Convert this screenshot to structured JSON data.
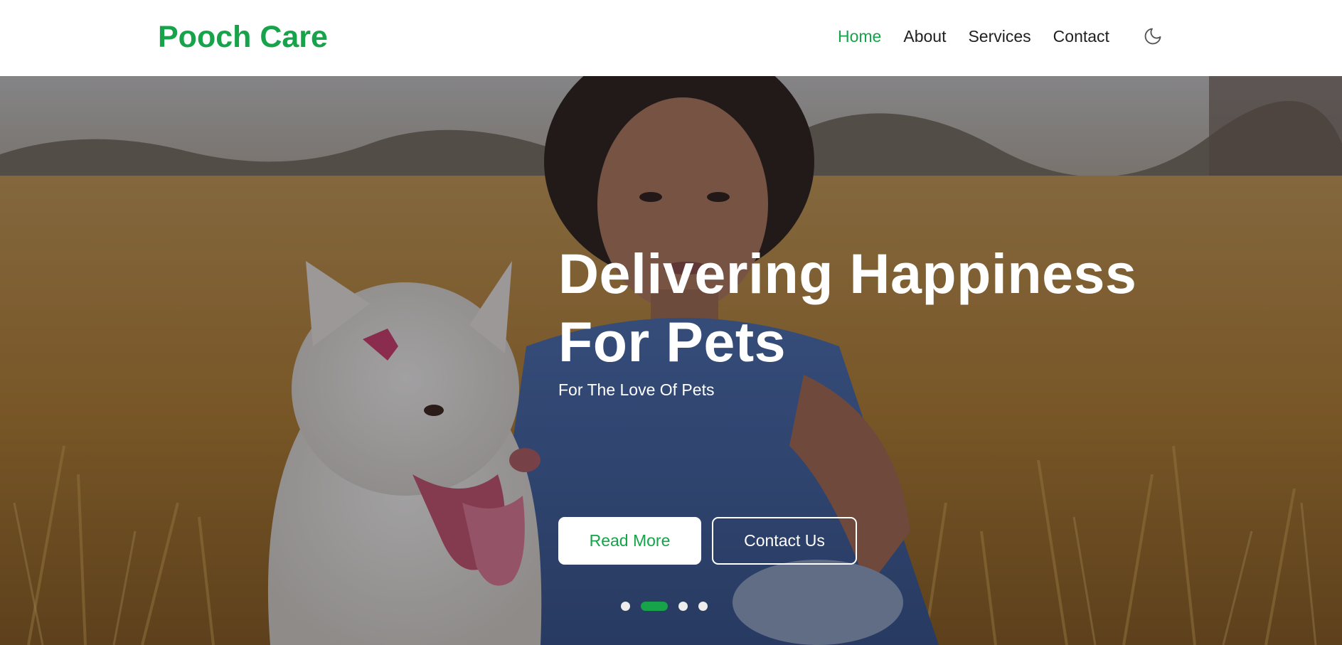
{
  "brand": {
    "name": "Pooch Care",
    "color": "#16a34a"
  },
  "nav": {
    "items": [
      {
        "label": "Home",
        "active": true
      },
      {
        "label": "About",
        "active": false
      },
      {
        "label": "Services",
        "active": false
      },
      {
        "label": "Contact",
        "active": false
      }
    ],
    "theme_toggle_icon": "moon-icon"
  },
  "hero": {
    "title_line1": "Delivering Happiness",
    "title_line2": "For Pets",
    "subtitle": "For The Love Of Pets",
    "buttons": {
      "primary_label": "Read More",
      "secondary_label": "Contact Us"
    },
    "background_image": "woman-with-white-dog-in-field",
    "slider": {
      "count": 4,
      "active_index": 1
    }
  },
  "colors": {
    "accent": "#16a34a",
    "text_dark": "#1f1f1f",
    "white": "#ffffff"
  }
}
